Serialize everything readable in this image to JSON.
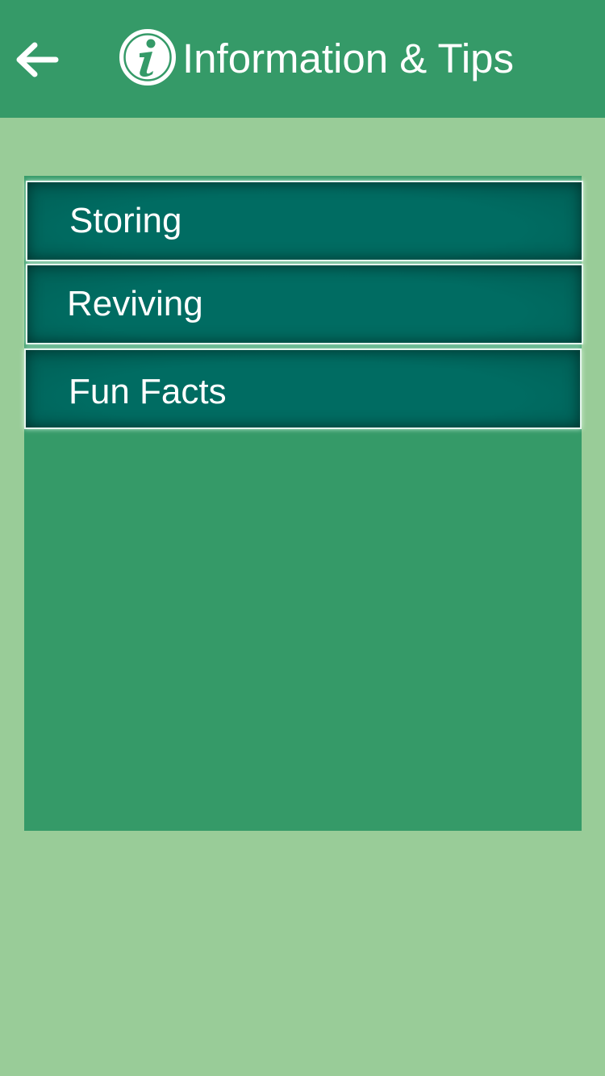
{
  "header": {
    "title": "Information & Tips",
    "back_icon": "arrow-left-icon",
    "info_icon": "info-icon",
    "background_color": "#359a68"
  },
  "menu": {
    "items": [
      {
        "label": "Storing"
      },
      {
        "label": "Reviving"
      },
      {
        "label": "Fun Facts"
      }
    ],
    "item_color": "#006c62"
  },
  "colors": {
    "page_background": "#99cc98",
    "panel_background": "#359a68",
    "text": "#ffffff"
  }
}
